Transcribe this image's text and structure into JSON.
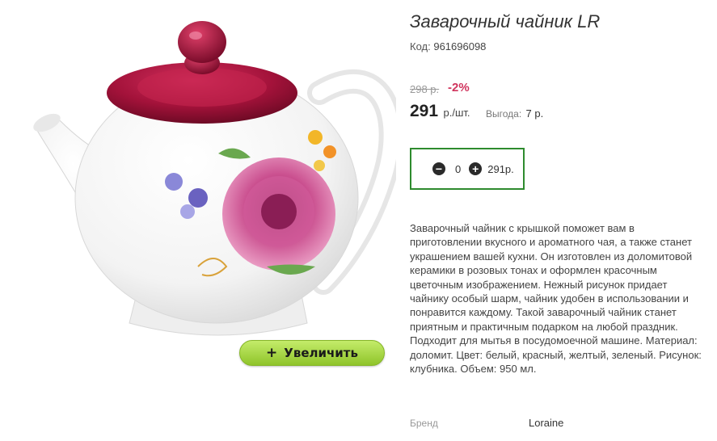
{
  "product": {
    "title": "Заварочный чайник LR",
    "code_label": "Код:",
    "code_value": "961696098",
    "image_alt": "teapot-image"
  },
  "pricing": {
    "old_price": "298 р.",
    "discount": "-2%",
    "price": "291",
    "unit": "р./шт.",
    "benefit_label": "Выгода:",
    "benefit_value": "7 р."
  },
  "quantity": {
    "minus_icon": "minus-icon",
    "plus_icon": "plus-icon",
    "value": "0",
    "total": "291р."
  },
  "zoom_button": {
    "plus": "+",
    "label": "Увеличить"
  },
  "description": "Заварочный чайник с крышкой поможет вам в приготовлении вкусного и ароматного чая, а также станет украшением вашей кухни. Он изготовлен из доломитовой керамики в розовых тонах и оформлен красочным цветочным изображением. Нежный рисунок придает чайнику особый шарм, чайник удобен в использовании и понравится каждому. Такой заварочный чайник станет приятным и практичным подарком на любой праздник. Подходит для мытья в посудомоечной машине. Материал: доломит. Цвет: белый, красный, желтый, зеленый. Рисунок: клубника. Объем: 950 мл.",
  "attributes": {
    "brand_label": "Бренд",
    "brand_value": "Loraine"
  },
  "colors": {
    "accent_green": "#2e8b2e",
    "discount_red": "#d0345d",
    "button_green": "#a6d93f",
    "lid_red": "#a3123a"
  }
}
